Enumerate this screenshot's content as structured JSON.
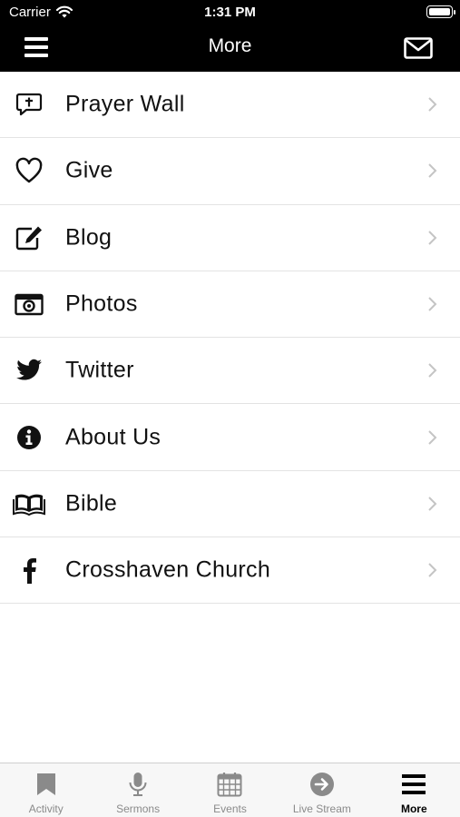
{
  "status_bar": {
    "carrier": "Carrier",
    "time": "1:31 PM"
  },
  "nav": {
    "title": "More"
  },
  "items": [
    {
      "label": "Prayer Wall",
      "icon": "prayer-icon"
    },
    {
      "label": "Give",
      "icon": "heart-icon"
    },
    {
      "label": "Blog",
      "icon": "edit-icon"
    },
    {
      "label": "Photos",
      "icon": "camera-icon"
    },
    {
      "label": "Twitter",
      "icon": "twitter-icon"
    },
    {
      "label": "About Us",
      "icon": "info-icon"
    },
    {
      "label": "Bible",
      "icon": "book-icon"
    },
    {
      "label": "Crosshaven Church",
      "icon": "facebook-icon"
    }
  ],
  "tabs": [
    {
      "label": "Activity",
      "icon": "bookmark-icon"
    },
    {
      "label": "Sermons",
      "icon": "microphone-icon"
    },
    {
      "label": "Events",
      "icon": "calendar-icon"
    },
    {
      "label": "Live Stream",
      "icon": "arrow-circle-icon"
    },
    {
      "label": "More",
      "icon": "menu-icon",
      "active": true
    }
  ],
  "colors": {
    "bar": "#000000",
    "tab_inactive": "#8a8a8a",
    "tab_active": "#000000",
    "divider": "#e3e3e3"
  }
}
